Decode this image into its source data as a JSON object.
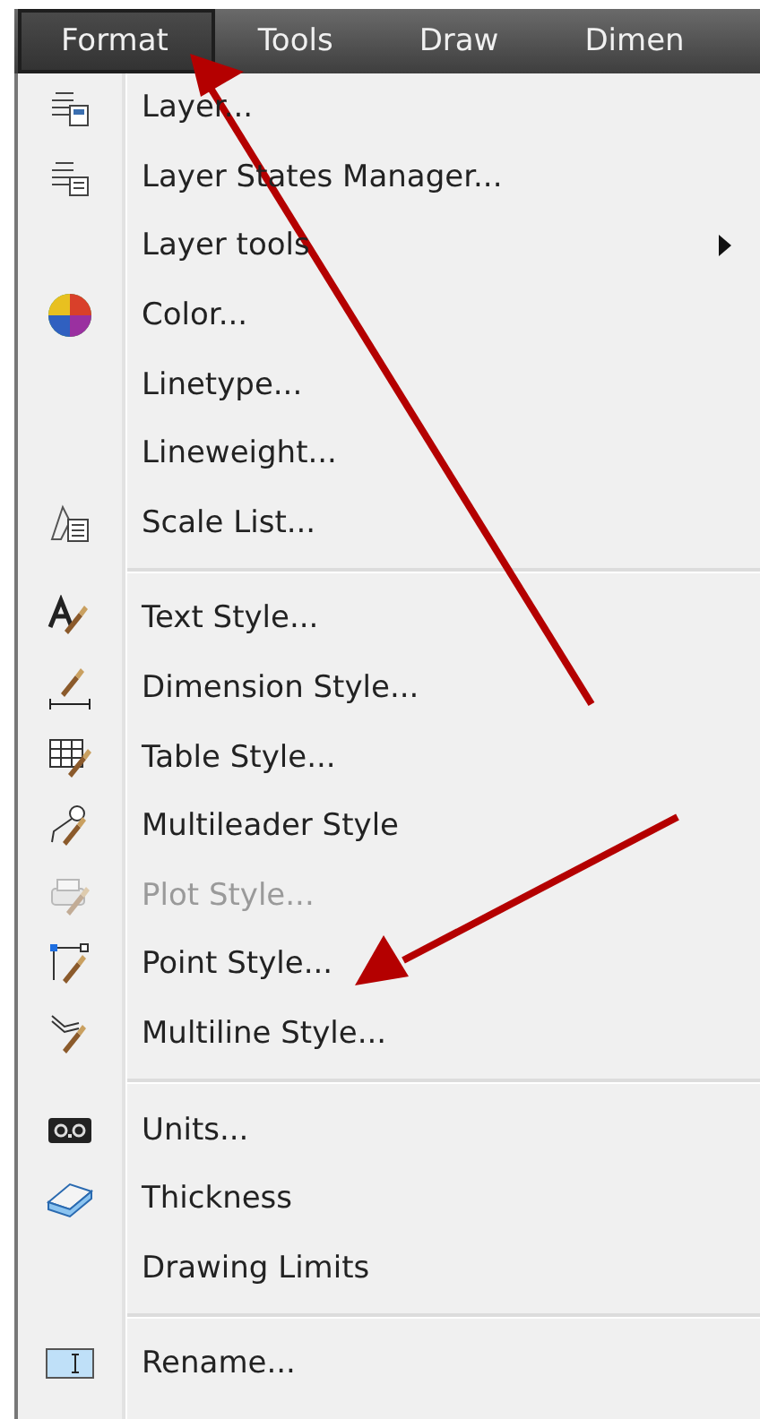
{
  "menubar": [
    {
      "label": "Format",
      "selected": true
    },
    {
      "label": "Tools",
      "selected": false
    },
    {
      "label": "Draw",
      "selected": false
    },
    {
      "label": "Dimen",
      "selected": false
    }
  ],
  "menu": {
    "groups": [
      {
        "items": [
          {
            "label": "Layer...",
            "disabled": false,
            "submenu": false
          },
          {
            "label": "Layer States Manager...",
            "disabled": false,
            "submenu": false
          },
          {
            "label": "Layer tools",
            "disabled": false,
            "submenu": true
          },
          {
            "label": "Color...",
            "disabled": false,
            "submenu": false
          },
          {
            "label": "Linetype...",
            "disabled": false,
            "submenu": false
          },
          {
            "label": "Lineweight...",
            "disabled": false,
            "submenu": false
          },
          {
            "label": "Scale List...",
            "disabled": false,
            "submenu": false
          }
        ]
      },
      {
        "items": [
          {
            "label": "Text Style...",
            "disabled": false,
            "submenu": false
          },
          {
            "label": "Dimension Style...",
            "disabled": false,
            "submenu": false
          },
          {
            "label": "Table Style...",
            "disabled": false,
            "submenu": false
          },
          {
            "label": "Multileader Style",
            "disabled": false,
            "submenu": false
          },
          {
            "label": "Plot Style...",
            "disabled": true,
            "submenu": false
          },
          {
            "label": "Point Style...",
            "disabled": false,
            "submenu": false
          },
          {
            "label": "Multiline Style...",
            "disabled": false,
            "submenu": false
          }
        ]
      },
      {
        "items": [
          {
            "label": "Units...",
            "disabled": false,
            "submenu": false
          },
          {
            "label": "Thickness",
            "disabled": false,
            "submenu": false
          },
          {
            "label": "Drawing Limits",
            "disabled": false,
            "submenu": false
          }
        ]
      },
      {
        "items": [
          {
            "label": "Rename...",
            "disabled": false,
            "submenu": false
          }
        ]
      }
    ]
  }
}
